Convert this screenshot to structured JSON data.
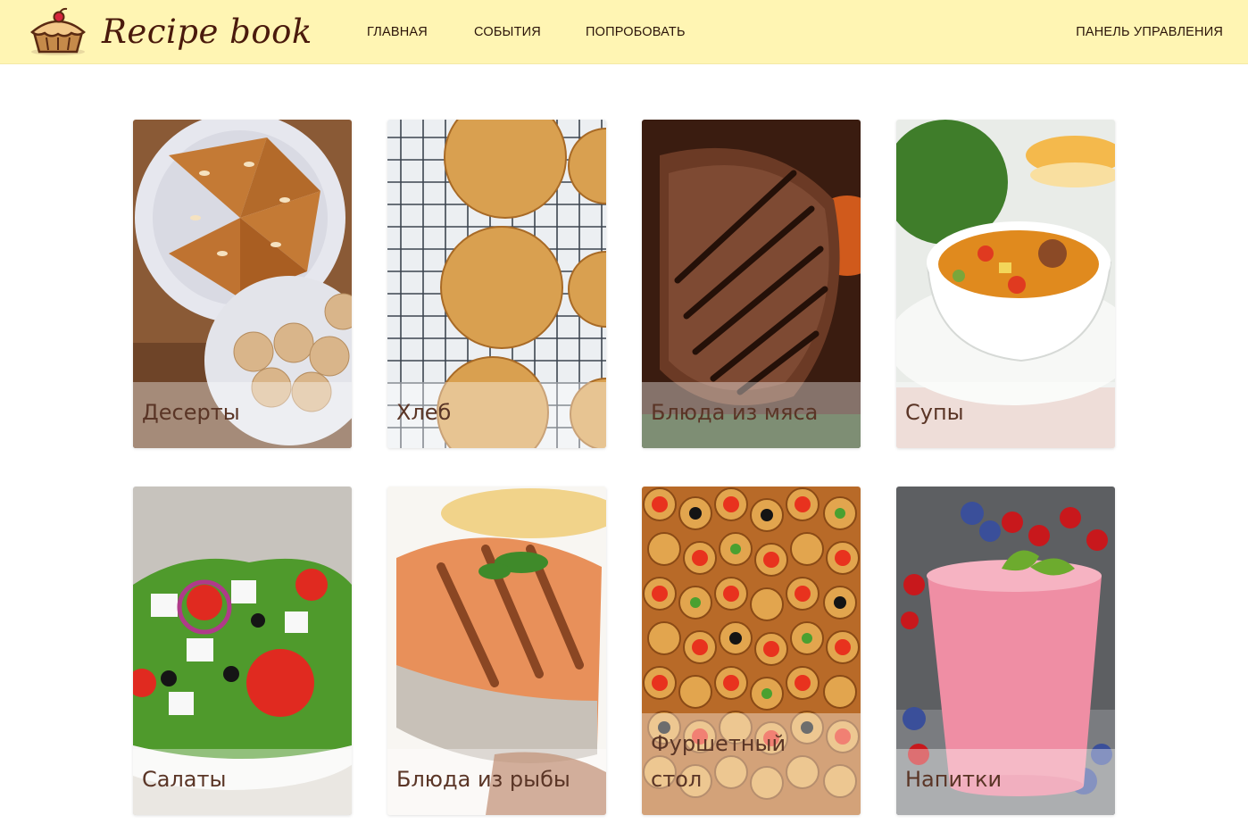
{
  "header": {
    "brand": "Recipe book",
    "logo_icon": "cupcake-icon",
    "nav": [
      {
        "label": "ГЛАВНАЯ"
      },
      {
        "label": "СОБЫТИЯ"
      },
      {
        "label": "ПОПРОБОВАТЬ"
      }
    ],
    "admin_link": "ПАНЕЛЬ УПРАВЛЕНИЯ",
    "colors": {
      "background": "#fff5b3",
      "brand": "#4a1a0c"
    }
  },
  "categories": [
    {
      "label": "Десерты",
      "image": "almond-cake-photo"
    },
    {
      "label": "Хлеб",
      "image": "bread-buns-photo"
    },
    {
      "label": "Блюда из мяса",
      "image": "grilled-steak-photo"
    },
    {
      "label": "Супы",
      "image": "vegetable-soup-photo"
    },
    {
      "label": "Салаты",
      "image": "greek-salad-photo"
    },
    {
      "label": "Блюда из рыбы",
      "image": "grilled-salmon-photo"
    },
    {
      "label": "Фуршетный стол",
      "image": "canapes-photo"
    },
    {
      "label": "Напитки",
      "image": "berry-smoothie-photo"
    }
  ]
}
